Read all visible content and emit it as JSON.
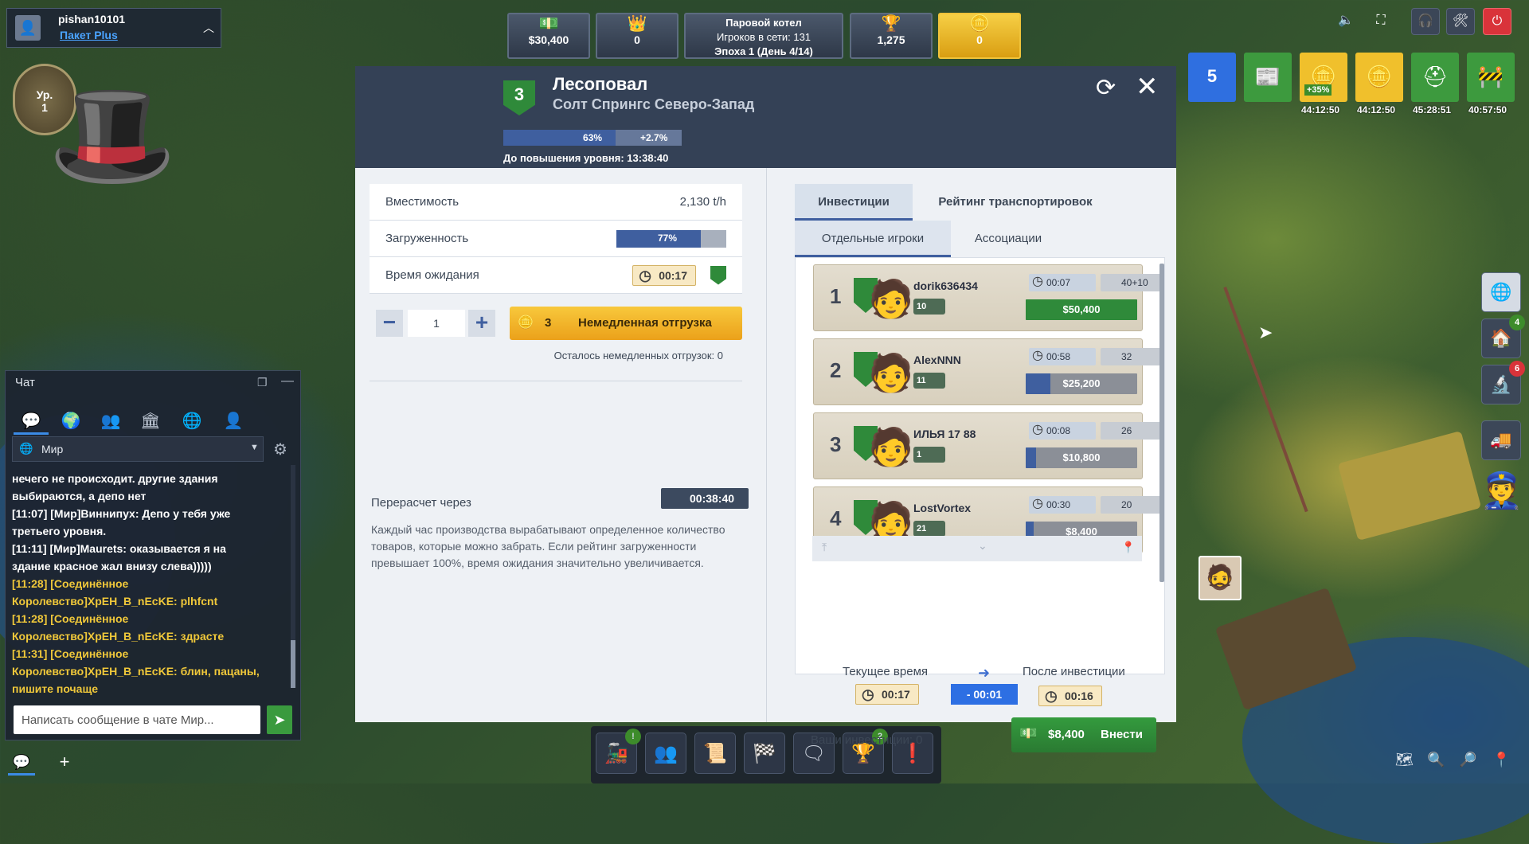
{
  "user": {
    "name": "pishan10101",
    "plan": "Пакет Plus",
    "level_label": "Ур.",
    "level": "1"
  },
  "hud": {
    "money": "$30,400",
    "stars": "0",
    "server_name": "Паровой котел",
    "online": "Игроков в сети: 131",
    "epoch": "Эпоха 1 (День 4/14)",
    "prestige": "1,275",
    "gold": "0"
  },
  "timers": {
    "t1": "44:12:50",
    "t2_badge": "+35%",
    "t2": "44:12:50",
    "t3": "45:28:51",
    "t4": "40:57:50"
  },
  "side_badges": {
    "depot": "4",
    "research": "6"
  },
  "building": {
    "level": "3",
    "name": "Лесоповал",
    "region": "Солт Спрингс Северо-Запад",
    "progress_pct": 63,
    "progress_label": "63%",
    "bonus": "+2.7%",
    "upgrade_label": "До повышения уровня:",
    "upgrade_time": "13:38:40"
  },
  "stats": {
    "capacity_label": "Вместимость",
    "capacity": "2,130 t/h",
    "load_label": "Загруженность",
    "load_pct": 77,
    "load_text": "77%",
    "wait_label": "Время ожидания",
    "wait": "00:17"
  },
  "dispatch": {
    "qty": "1",
    "cost": "3",
    "button": "Немедленная отгрузка",
    "remaining": "Осталось немедленных отгрузок: 0"
  },
  "recalc": {
    "label": "Перерасчет через",
    "time": "00:38:40"
  },
  "description": "Каждый час производства вырабатывают определенное количество товаров, которые можно забрать. Если рейтинг загруженности превышает 100%, время ожидания значительно увеличивается.",
  "tabs": {
    "invest": "Инвестиции",
    "rating": "Рейтинг транспортировок",
    "players": "Отдельные игроки",
    "assoc": "Ассоциации"
  },
  "players": [
    {
      "rank": "1",
      "name": "dorik636434",
      "level": "10",
      "time": "00:07",
      "rating": "40+10",
      "amount": "$50,400",
      "fill": 1.0,
      "color": "#2f8a3a"
    },
    {
      "rank": "2",
      "name": "AlexNNN",
      "level": "11",
      "time": "00:58",
      "rating": "32",
      "amount": "$25,200",
      "fill": 0.22,
      "color": "#3f5f9f"
    },
    {
      "rank": "3",
      "name": "ИЛЬЯ 17 88",
      "level": "1",
      "time": "00:08",
      "rating": "26",
      "amount": "$10,800",
      "fill": 0.09,
      "color": "#3f5f9f"
    },
    {
      "rank": "4",
      "name": "LostVortex",
      "level": "21",
      "time": "00:30",
      "rating": "20",
      "amount": "$8,400",
      "fill": 0.07,
      "color": "#3f5f9f"
    }
  ],
  "compare": {
    "current_label": "Текущее время",
    "current": "00:17",
    "delta": "- 00:01",
    "after_label": "После инвестиции",
    "after": "00:16"
  },
  "invest": {
    "label": "Ваши инвестиции: 0",
    "amount": "$8,400",
    "button": "Внести"
  },
  "chat": {
    "title": "Чат",
    "channel": "Мир",
    "placeholder": "Написать сообщение в чате Мир...",
    "lines": [
      {
        "text": "нечего не происходит. другие здания",
        "y": false
      },
      {
        "text": "выбираются, а депо нет",
        "y": false
      },
      {
        "text": "[11:07] [Мир]Виннипух: Депо у тебя уже",
        "y": false
      },
      {
        "text": "третьего уровня.",
        "y": false
      },
      {
        "text": "[11:11] [Мир]Maurets: оказывается я на",
        "y": false
      },
      {
        "text": "здание красное жал внизу слева)))))",
        "y": false
      },
      {
        "text": "[11:28] [Соединённое",
        "y": true
      },
      {
        "text": "Королевство]XpEH_B_nEcKE: plhfcnt",
        "y": true
      },
      {
        "text": "[11:28] [Соединённое",
        "y": true
      },
      {
        "text": "Королевство]XpEH_B_nEcKE: здрасте",
        "y": true
      },
      {
        "text": "[11:31] [Соединённое",
        "y": true
      },
      {
        "text": "Королевство]XpEH_B_nEcKE: блин, пацаны,",
        "y": true
      },
      {
        "text": "пишите почаще",
        "y": true
      }
    ]
  },
  "bottom_badges": {
    "trains": "!",
    "awards": "2",
    "alert": "!"
  },
  "colors": {
    "accent_blue": "#3f5f9f",
    "gold": "#f2b827",
    "green": "#2f8a3a",
    "danger": "#d9333a"
  }
}
